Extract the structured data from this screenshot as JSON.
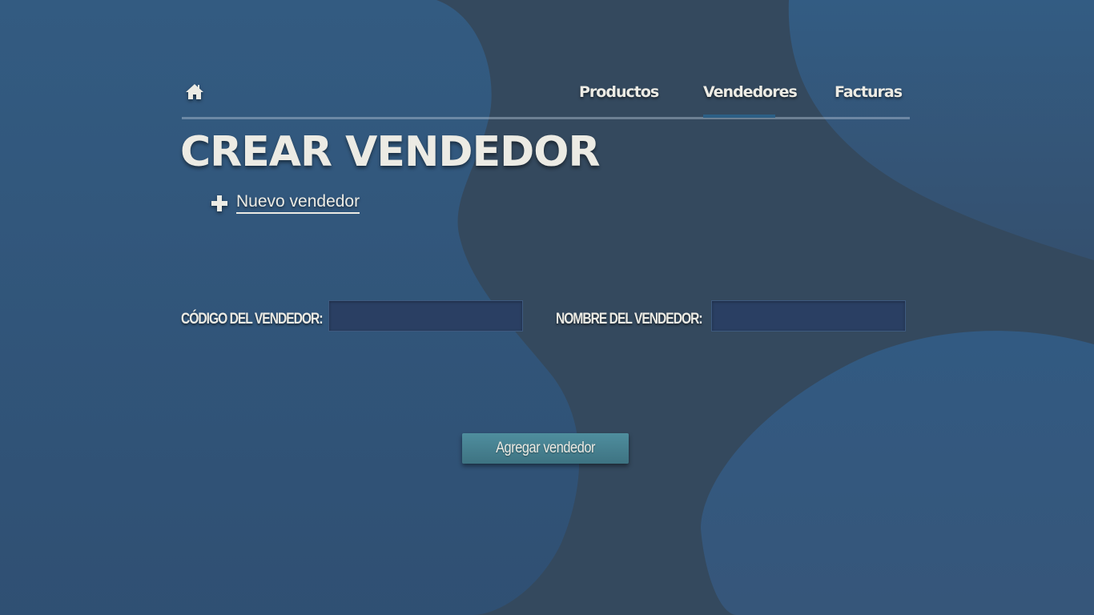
{
  "colors": {
    "background": "#34495e",
    "blob": "#2f5a82",
    "text": "#ecebe4",
    "input_bg": "#2a3f63",
    "button_bg": "#4a8796",
    "nav_active": "#2c5f86"
  },
  "nav": {
    "home_icon": "home-icon",
    "items": [
      {
        "label": "Productos"
      },
      {
        "label": "Vendedores",
        "active": true
      },
      {
        "label": "Facturas"
      }
    ]
  },
  "main": {
    "title": "CREAR VENDEDOR",
    "new_link": {
      "icon": "plus-icon",
      "label": "Nuevo vendedor"
    }
  },
  "form": {
    "codigo_label": "CÓDIGO DEL VENDEDOR:",
    "codigo_value": "",
    "nombre_label": "NOMBRE DEL VENDEDOR:",
    "nombre_value": "",
    "submit_label": "Agregar vendedor"
  }
}
